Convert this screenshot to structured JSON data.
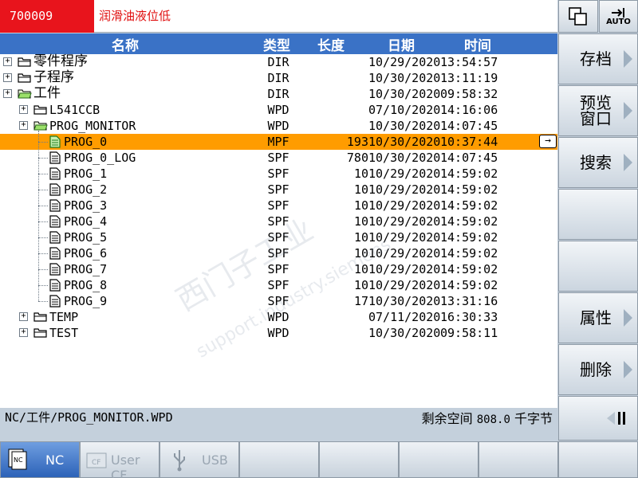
{
  "alarm": {
    "number": "700009",
    "text": "润滑油液位低"
  },
  "top_buttons": {
    "mode_label": "AUTO"
  },
  "table": {
    "headers": {
      "name": "名称",
      "type": "类型",
      "length": "长度",
      "date": "日期",
      "time": "时间"
    },
    "rows": [
      {
        "name": "零件程序",
        "type": "DIR",
        "length": "",
        "date": "10/29/2020",
        "time": "13:54:57",
        "level": 0,
        "kind": "folder"
      },
      {
        "name": "子程序",
        "type": "DIR",
        "length": "",
        "date": "10/30/2020",
        "time": "13:11:19",
        "level": 0,
        "kind": "folder"
      },
      {
        "name": "工件",
        "type": "DIR",
        "length": "",
        "date": "10/30/2020",
        "time": "09:58:32",
        "level": 0,
        "kind": "folder-open"
      },
      {
        "name": "L541CCB",
        "type": "WPD",
        "length": "",
        "date": "07/10/2020",
        "time": "14:16:06",
        "level": 1,
        "kind": "folder"
      },
      {
        "name": "PROG_MONITOR",
        "type": "WPD",
        "length": "",
        "date": "10/30/2020",
        "time": "14:07:45",
        "level": 1,
        "kind": "folder-open"
      },
      {
        "name": "PROG_0",
        "type": "MPF",
        "length": "193",
        "date": "10/30/2020",
        "time": "10:37:44",
        "level": 2,
        "kind": "file",
        "selected": true
      },
      {
        "name": "PROG_0_LOG",
        "type": "SPF",
        "length": "780",
        "date": "10/30/2020",
        "time": "14:07:45",
        "level": 2,
        "kind": "file"
      },
      {
        "name": "PROG_1",
        "type": "SPF",
        "length": "10",
        "date": "10/29/2020",
        "time": "14:59:02",
        "level": 2,
        "kind": "file"
      },
      {
        "name": "PROG_2",
        "type": "SPF",
        "length": "10",
        "date": "10/29/2020",
        "time": "14:59:02",
        "level": 2,
        "kind": "file"
      },
      {
        "name": "PROG_3",
        "type": "SPF",
        "length": "10",
        "date": "10/29/2020",
        "time": "14:59:02",
        "level": 2,
        "kind": "file"
      },
      {
        "name": "PROG_4",
        "type": "SPF",
        "length": "10",
        "date": "10/29/2020",
        "time": "14:59:02",
        "level": 2,
        "kind": "file"
      },
      {
        "name": "PROG_5",
        "type": "SPF",
        "length": "10",
        "date": "10/29/2020",
        "time": "14:59:02",
        "level": 2,
        "kind": "file"
      },
      {
        "name": "PROG_6",
        "type": "SPF",
        "length": "10",
        "date": "10/29/2020",
        "time": "14:59:02",
        "level": 2,
        "kind": "file"
      },
      {
        "name": "PROG_7",
        "type": "SPF",
        "length": "10",
        "date": "10/29/2020",
        "time": "14:59:02",
        "level": 2,
        "kind": "file"
      },
      {
        "name": "PROG_8",
        "type": "SPF",
        "length": "10",
        "date": "10/29/2020",
        "time": "14:59:02",
        "level": 2,
        "kind": "file"
      },
      {
        "name": "PROG_9",
        "type": "SPF",
        "length": "17",
        "date": "10/30/2020",
        "time": "13:31:16",
        "level": 2,
        "kind": "file"
      },
      {
        "name": "TEMP",
        "type": "WPD",
        "length": "",
        "date": "07/11/2020",
        "time": "16:30:33",
        "level": 1,
        "kind": "folder"
      },
      {
        "name": "TEST",
        "type": "WPD",
        "length": "",
        "date": "10/30/2020",
        "time": "09:58:11",
        "level": 1,
        "kind": "folder"
      }
    ]
  },
  "status": {
    "path": "NC/工件/PROG_MONITOR.WPD",
    "free_label": "剩余空间",
    "free_value": "808.0",
    "free_unit": "千字节"
  },
  "softkeys_vertical": [
    {
      "label": "存档",
      "two_line": false
    },
    {
      "label": "",
      "two_line": false
    },
    {
      "label": "预览\n窗口",
      "two_line": true
    },
    {
      "label": "搜索",
      "two_line": false
    },
    {
      "label": "",
      "two_line": false
    },
    {
      "label": "",
      "two_line": false
    },
    {
      "label": "属性",
      "two_line": false
    },
    {
      "label": "删除",
      "two_line": false
    },
    {
      "label": "",
      "two_line": false
    }
  ],
  "softkeys_horizontal": [
    {
      "label": "NC",
      "active": true
    },
    {
      "label": "User CF",
      "disabled": true
    },
    {
      "label": "USB",
      "disabled": true
    },
    {
      "label": ""
    },
    {
      "label": ""
    },
    {
      "label": ""
    },
    {
      "label": ""
    }
  ],
  "colors": {
    "selected_row": "#ff9c00",
    "header": "#3a72c6",
    "alarm": "#e8141c"
  }
}
